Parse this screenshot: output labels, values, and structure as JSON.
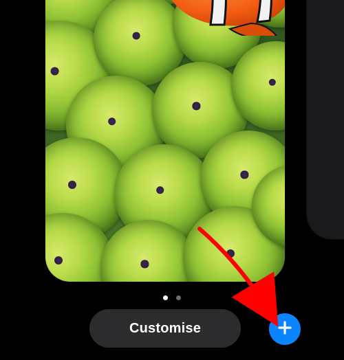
{
  "colors": {
    "accent": "#0a84ff",
    "buttonBg": "#2c2c2e",
    "text": "#ffffff"
  },
  "pager": {
    "count": 2,
    "activeIndex": 0
  },
  "buttons": {
    "customise": {
      "label": "Customise"
    },
    "add": {
      "icon": "plus-icon"
    }
  },
  "wallpaper": {
    "description": "Clownfish among green sea anemones",
    "subjects": [
      "clownfish",
      "sea-anemone"
    ]
  },
  "annotation": {
    "type": "arrow",
    "color": "#ff0000",
    "target": "add-button"
  }
}
